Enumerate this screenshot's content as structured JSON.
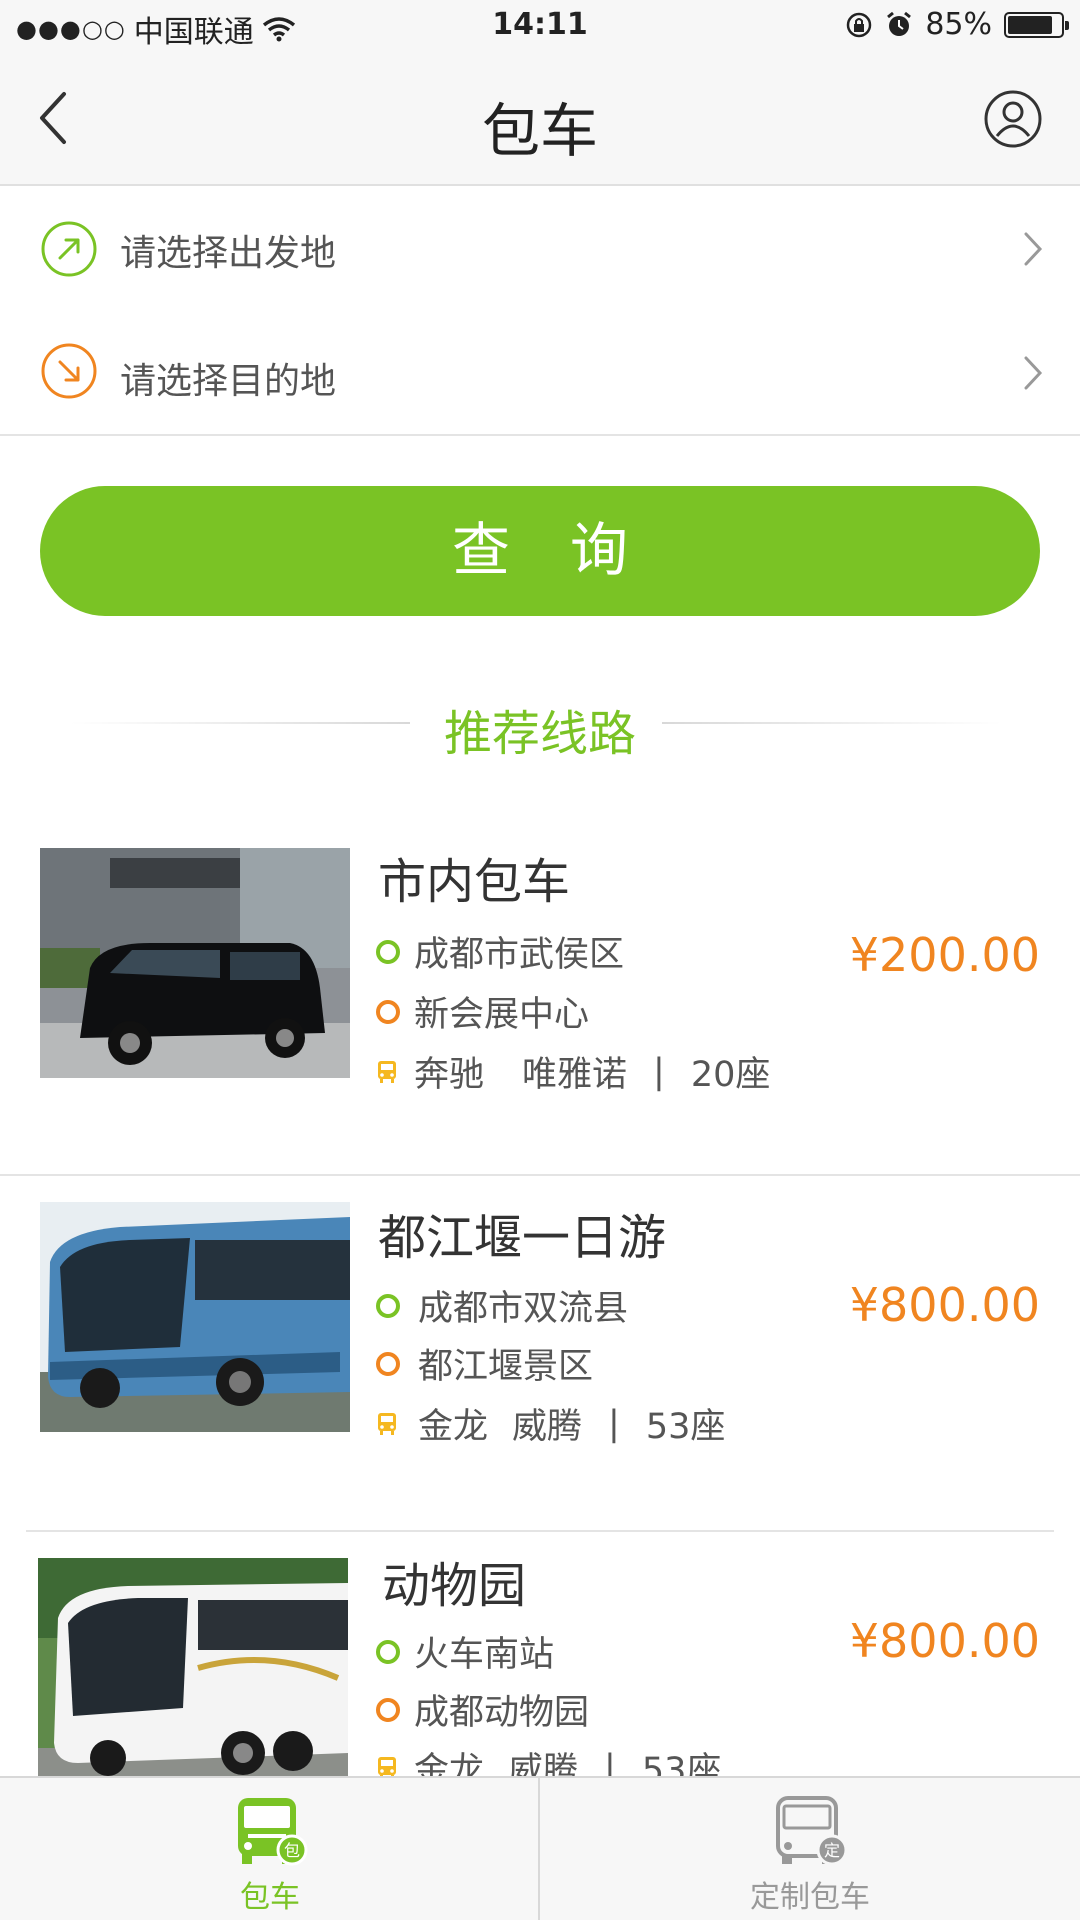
{
  "status_bar": {
    "carrier": "中国联通",
    "time": "14:11",
    "battery": "85%",
    "battery_level": 0.85
  },
  "header": {
    "title": "包车",
    "back_icon": "chevron-left-icon",
    "profile_icon": "user-circle-icon"
  },
  "locations": {
    "origin_placeholder": "请选择出发地",
    "destination_placeholder": "请选择目的地"
  },
  "search": {
    "label": "查询"
  },
  "recommended": {
    "title": "推荐线路",
    "routes": [
      {
        "title": "市内包车",
        "from": "成都市武侯区",
        "to": "新会展中心",
        "brand": "奔驰",
        "model": "唯雅诺",
        "seats": "20座",
        "price": "¥200.00",
        "image": "black-van-photo"
      },
      {
        "title": "都江堰一日游",
        "from": "成都市双流县",
        "to": "都江堰景区",
        "brand": "金龙",
        "model": "威腾",
        "seats": "53座",
        "price": "¥800.00",
        "image": "blue-coach-photo"
      },
      {
        "title": "动物园",
        "from": "火车南站",
        "to": "成都动物园",
        "brand": "金龙",
        "model": "威腾",
        "seats": "53座",
        "price": "¥800.00",
        "image": "white-coach-photo"
      }
    ]
  },
  "tab_bar": {
    "tabs": [
      {
        "label": "包车",
        "active": true
      },
      {
        "label": "定制包车",
        "active": false
      }
    ]
  },
  "colors": {
    "accent_green": "#7ac325",
    "price_orange": "#f08520"
  }
}
